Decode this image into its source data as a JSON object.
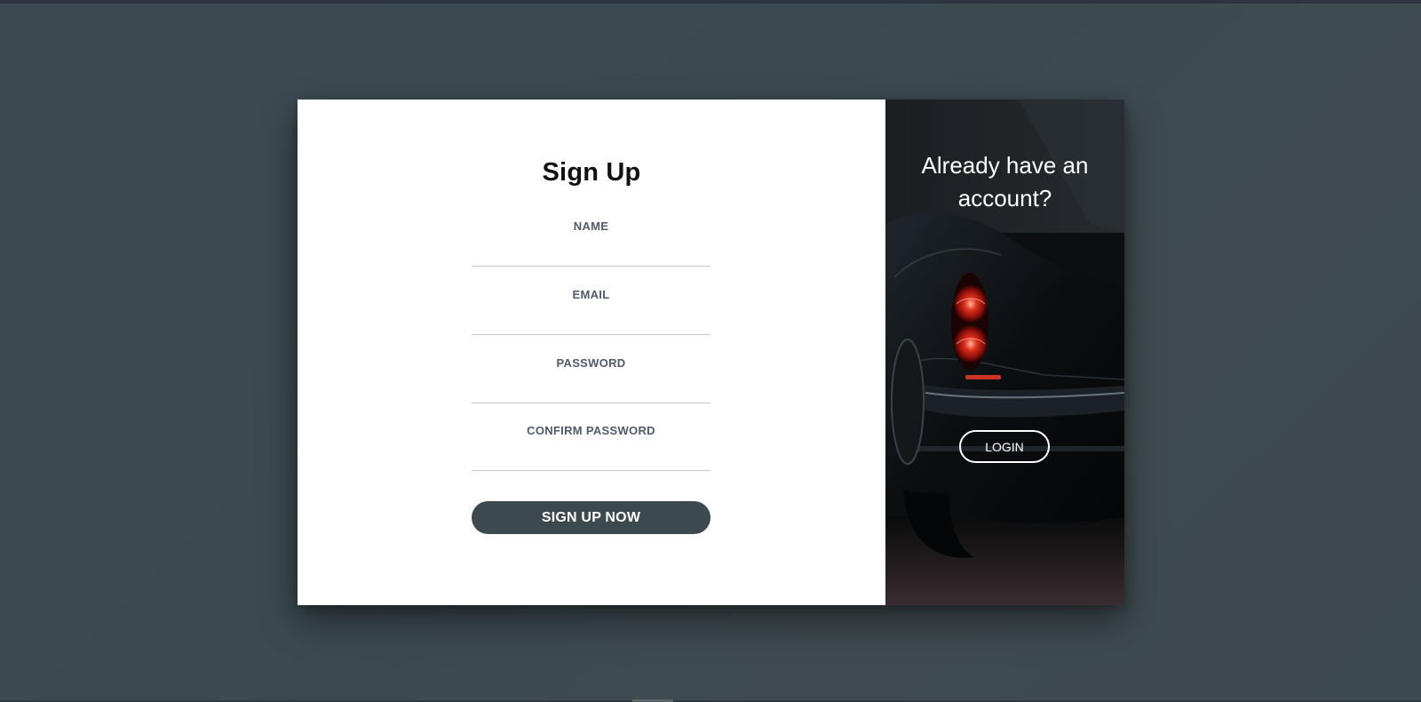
{
  "signup": {
    "title": "Sign Up",
    "fields": {
      "name_label": "NAME",
      "email_label": "EMAIL",
      "password_label": "PASSWORD",
      "confirm_label": "CONFIRM PASSWORD",
      "name_value": "",
      "email_value": "",
      "password_value": "",
      "confirm_value": ""
    },
    "submit_label": "SIGN UP NOW"
  },
  "login_panel": {
    "heading_line1": "Already have an",
    "heading_line2": "account?",
    "login_label": "LOGIN"
  },
  "colors": {
    "page_background": "#3d4a50",
    "button_dark": "#3c4a50",
    "label_text": "#4f5a6a",
    "card_background": "#ffffff"
  },
  "icons": {
    "background_photo": "car-taillight-photo"
  }
}
